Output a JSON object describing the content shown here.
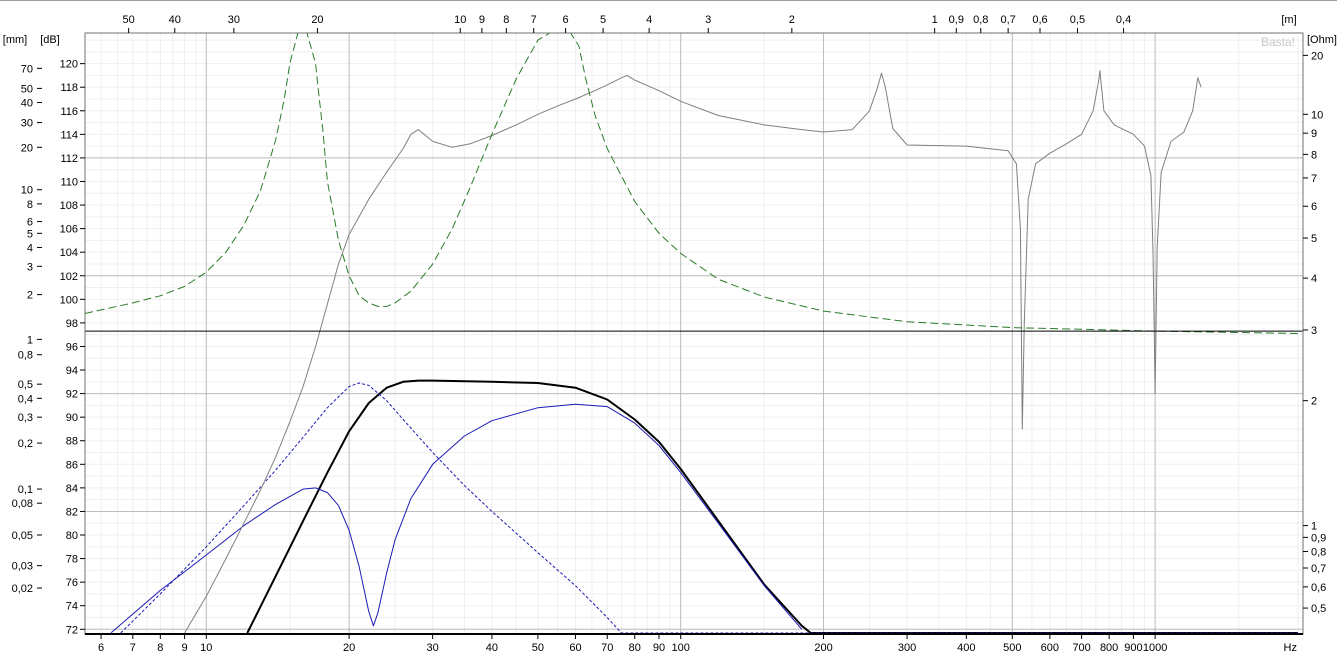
{
  "chart_data": {
    "type": "line",
    "title": "",
    "watermark": "Basta!",
    "xlabel": "Hz",
    "x_scale": "log",
    "xlim": [
      5.55,
      2050
    ],
    "x_ticks": [
      {
        "v": 6,
        "label": "6"
      },
      {
        "v": 7,
        "label": "7"
      },
      {
        "v": 8,
        "label": "8"
      },
      {
        "v": 9,
        "label": "9"
      },
      {
        "v": 10,
        "label": "10"
      },
      {
        "v": 20,
        "label": "20"
      },
      {
        "v": 30,
        "label": "30"
      },
      {
        "v": 40,
        "label": "40"
      },
      {
        "v": 50,
        "label": "50"
      },
      {
        "v": 60,
        "label": "60"
      },
      {
        "v": 70,
        "label": "70"
      },
      {
        "v": 80,
        "label": "80"
      },
      {
        "v": 90,
        "label": "90"
      },
      {
        "v": 100,
        "label": "100"
      },
      {
        "v": 200,
        "label": "200"
      },
      {
        "v": 300,
        "label": "300"
      },
      {
        "v": 400,
        "label": "400"
      },
      {
        "v": 500,
        "label": "500"
      },
      {
        "v": 600,
        "label": "600"
      },
      {
        "v": 700,
        "label": "700"
      },
      {
        "v": 800,
        "label": "800"
      },
      {
        "v": 900,
        "label": "900"
      },
      {
        "v": 1000,
        "label": "1000"
      }
    ],
    "top_axis": {
      "unit": "[m]",
      "ticks": [
        {
          "label": "50",
          "v": 6.86
        },
        {
          "label": "40",
          "v": 8.58
        },
        {
          "label": "30",
          "v": 11.43
        },
        {
          "label": "20",
          "v": 17.15
        },
        {
          "label": "10",
          "v": 34.3
        },
        {
          "label": "9",
          "v": 38.1
        },
        {
          "label": "8",
          "v": 42.9
        },
        {
          "label": "7",
          "v": 49.0
        },
        {
          "label": "6",
          "v": 57.2
        },
        {
          "label": "5",
          "v": 68.6
        },
        {
          "label": "4",
          "v": 85.8
        },
        {
          "label": "3",
          "v": 114.3
        },
        {
          "label": "2",
          "v": 171.5
        },
        {
          "label": "1",
          "v": 343
        },
        {
          "label": "0,9",
          "v": 381
        },
        {
          "label": "0,8",
          "v": 429
        },
        {
          "label": "0,7",
          "v": 490
        },
        {
          "label": "0,6",
          "v": 572
        },
        {
          "label": "0,5",
          "v": 686
        },
        {
          "label": "0,4",
          "v": 858
        }
      ]
    },
    "y_db": {
      "unit": "[dB]",
      "ylim": [
        71.6,
        122.6
      ],
      "ticks": [
        72,
        74,
        76,
        78,
        80,
        82,
        84,
        86,
        88,
        90,
        92,
        94,
        96,
        98,
        100,
        102,
        104,
        106,
        108,
        110,
        112,
        114,
        116,
        118,
        120
      ]
    },
    "y_mm": {
      "unit": "[mm]",
      "scale": "log",
      "ticks": [
        {
          "v": 0.02,
          "label": "0,02",
          "db": 75.5
        },
        {
          "v": 0.03,
          "label": "0,03",
          "db": 77.4
        },
        {
          "v": 0.05,
          "label": "0,05",
          "db": 80.0
        },
        {
          "v": 0.08,
          "label": "0,08",
          "db": 82.7
        },
        {
          "v": 0.1,
          "label": "0,1",
          "db": 83.9
        },
        {
          "v": 0.2,
          "label": "0,2",
          "db": 87.8
        },
        {
          "v": 0.3,
          "label": "0,3",
          "db": 90.0
        },
        {
          "v": 0.4,
          "label": "0,4",
          "db": 91.6
        },
        {
          "v": 0.5,
          "label": "0,5",
          "db": 92.8
        },
        {
          "v": 0.8,
          "label": "0,8",
          "db": 95.3
        },
        {
          "v": 1,
          "label": "1",
          "db": 96.6
        },
        {
          "v": 2,
          "label": "2",
          "db": 100.4
        },
        {
          "v": 3,
          "label": "3",
          "db": 102.8
        },
        {
          "v": 4,
          "label": "4",
          "db": 104.4
        },
        {
          "v": 5,
          "label": "5",
          "db": 105.6
        },
        {
          "v": 6,
          "label": "6",
          "db": 106.6
        },
        {
          "v": 8,
          "label": "8",
          "db": 108.1
        },
        {
          "v": 10,
          "label": "10",
          "db": 109.3
        },
        {
          "v": 20,
          "label": "20",
          "db": 112.9
        },
        {
          "v": 30,
          "label": "30",
          "db": 115.0
        },
        {
          "v": 40,
          "label": "40",
          "db": 116.7
        },
        {
          "v": 50,
          "label": "50",
          "db": 117.9
        },
        {
          "v": 70,
          "label": "70",
          "db": 119.6
        }
      ]
    },
    "y_ohm": {
      "unit": "[Ohm]",
      "scale": "log",
      "ticks": [
        {
          "v": 0.5,
          "label": "0,5",
          "db": 73.8
        },
        {
          "v": 0.6,
          "label": "0,6",
          "db": 75.6
        },
        {
          "v": 0.7,
          "label": "0,7",
          "db": 77.2
        },
        {
          "v": 0.8,
          "label": "0,8",
          "db": 78.6
        },
        {
          "v": 0.9,
          "label": "0,9",
          "db": 79.8
        },
        {
          "v": 1,
          "label": "1",
          "db": 80.8
        },
        {
          "v": 2,
          "label": "2",
          "db": 91.4
        },
        {
          "v": 3,
          "label": "3",
          "db": 97.4
        },
        {
          "v": 4,
          "label": "4",
          "db": 101.8
        },
        {
          "v": 5,
          "label": "5",
          "db": 105.2
        },
        {
          "v": 6,
          "label": "6",
          "db": 107.9
        },
        {
          "v": 7,
          "label": "7",
          "db": 110.3
        },
        {
          "v": 8,
          "label": "8",
          "db": 112.3
        },
        {
          "v": 9,
          "label": "9",
          "db": 114.1
        },
        {
          "v": 10,
          "label": "10",
          "db": 115.7
        },
        {
          "v": 20,
          "label": "20",
          "db": 120.7
        }
      ]
    },
    "reference_line_db": 97.3,
    "series": [
      {
        "color": "#000000",
        "width": 2,
        "dash": "",
        "x": [
          12.2,
          14,
          16,
          18,
          20,
          22,
          24,
          26,
          28,
          30,
          40,
          50,
          60,
          70,
          80,
          90,
          100,
          120,
          150,
          180,
          188,
          300,
          500,
          1000,
          2000
        ],
        "y": [
          71.6,
          76.5,
          81.2,
          85.3,
          88.8,
          91.2,
          92.5,
          93.0,
          93.1,
          93.1,
          93.0,
          92.9,
          92.5,
          91.5,
          89.8,
          87.9,
          85.6,
          81.2,
          75.8,
          72.3,
          71.6,
          71.6,
          71.6,
          71.6,
          71.6
        ]
      },
      {
        "color": "#1a1ab4",
        "width": 1,
        "dash": "",
        "x": [
          6.3,
          8,
          10,
          12,
          14,
          16,
          17,
          18,
          19,
          20,
          21,
          22,
          22.5,
          23,
          24,
          25,
          27,
          30,
          35,
          40,
          50,
          60,
          70,
          80,
          90,
          100,
          120,
          150,
          180
        ],
        "y": [
          71.7,
          75.3,
          78.3,
          80.8,
          82.6,
          83.9,
          84.0,
          83.6,
          82.5,
          80.4,
          77.3,
          73.5,
          72.3,
          73.4,
          76.8,
          79.6,
          83.1,
          86.0,
          88.4,
          89.7,
          90.8,
          91.1,
          90.9,
          89.5,
          87.6,
          85.3,
          81.0,
          75.7,
          72.0
        ]
      },
      {
        "color": "#1a1ab4",
        "width": 1,
        "dash": "3,2",
        "x": [
          6.6,
          8,
          10,
          12,
          14,
          16,
          18,
          20,
          21,
          22,
          24,
          26,
          30,
          35,
          40,
          50,
          60,
          70,
          75,
          80,
          2000
        ],
        "y": [
          71.6,
          75.0,
          79.0,
          82.5,
          85.5,
          88.3,
          90.8,
          92.6,
          92.9,
          92.7,
          91.4,
          89.8,
          87.0,
          84.2,
          82.0,
          78.5,
          75.7,
          73.0,
          71.6,
          71.6,
          71.6
        ]
      },
      {
        "color": "#808080",
        "width": 1,
        "dash": "",
        "x": [
          9,
          10,
          11,
          12,
          13,
          14,
          15,
          16,
          17,
          18,
          19,
          20,
          22,
          24,
          26,
          27,
          28,
          30,
          33,
          36,
          40,
          45,
          50,
          55,
          60,
          65,
          70,
          75,
          77,
          80,
          90,
          100,
          120,
          150,
          180,
          200,
          230,
          250,
          260,
          265,
          270,
          280,
          300,
          400,
          490,
          510,
          520,
          525,
          530,
          540,
          560,
          600,
          650,
          700,
          740,
          760,
          765,
          770,
          780,
          820,
          900,
          950,
          980,
          990,
          995,
          1000,
          1005,
          1010,
          1030,
          1080,
          1150,
          1200,
          1230,
          1250
        ],
        "y": [
          71.6,
          74.8,
          78.0,
          81.0,
          83.8,
          86.6,
          89.6,
          92.6,
          96.0,
          99.6,
          103.0,
          105.5,
          108.5,
          110.8,
          112.8,
          114.0,
          114.4,
          113.4,
          112.9,
          113.2,
          113.9,
          114.8,
          115.7,
          116.4,
          117.0,
          117.6,
          118.2,
          118.8,
          119.0,
          118.6,
          117.7,
          116.8,
          115.6,
          114.8,
          114.4,
          114.2,
          114.4,
          116.0,
          118.0,
          119.2,
          118.0,
          114.5,
          113.1,
          113.0,
          112.6,
          111.5,
          106.0,
          89.0,
          98.0,
          108.5,
          111.5,
          112.4,
          113.2,
          114.0,
          116.0,
          118.5,
          119.4,
          118.2,
          116.0,
          114.8,
          114.0,
          113.0,
          110.5,
          104.0,
          98.0,
          92.0,
          98.0,
          104.5,
          110.8,
          113.4,
          114.2,
          116.0,
          118.8,
          118.0
        ]
      },
      {
        "color": "#2a7a2a",
        "width": 1,
        "dash": "8,4",
        "x": [
          5.55,
          6,
          7,
          8,
          9,
          10,
          11,
          12,
          13,
          14,
          14.6,
          15,
          15.6,
          16.3,
          17,
          17.2,
          17.6,
          18,
          19,
          20,
          21,
          22,
          23,
          24,
          25,
          27,
          30,
          33,
          36,
          40,
          45,
          50,
          53,
          55,
          55.6,
          58,
          58.6,
          61,
          63,
          66,
          70,
          80,
          90,
          100,
          120,
          150,
          200,
          300,
          500,
          1000,
          2000
        ],
        "y": [
          98.8,
          99.1,
          99.7,
          100.3,
          101.1,
          102.3,
          104.0,
          106.3,
          109.2,
          113.5,
          117.0,
          120.0,
          122.6,
          122.6,
          120.0,
          118.0,
          114.4,
          110.0,
          105.0,
          102.0,
          100.3,
          99.7,
          99.4,
          99.4,
          99.7,
          100.7,
          103.0,
          106.0,
          109.5,
          114.0,
          118.7,
          122.0,
          122.6,
          122.6,
          122.6,
          122.6,
          122.6,
          121.5,
          118.8,
          115.6,
          112.8,
          108.3,
          105.6,
          103.9,
          101.7,
          100.2,
          99.0,
          98.1,
          97.6,
          97.3,
          97.1
        ]
      }
    ]
  }
}
